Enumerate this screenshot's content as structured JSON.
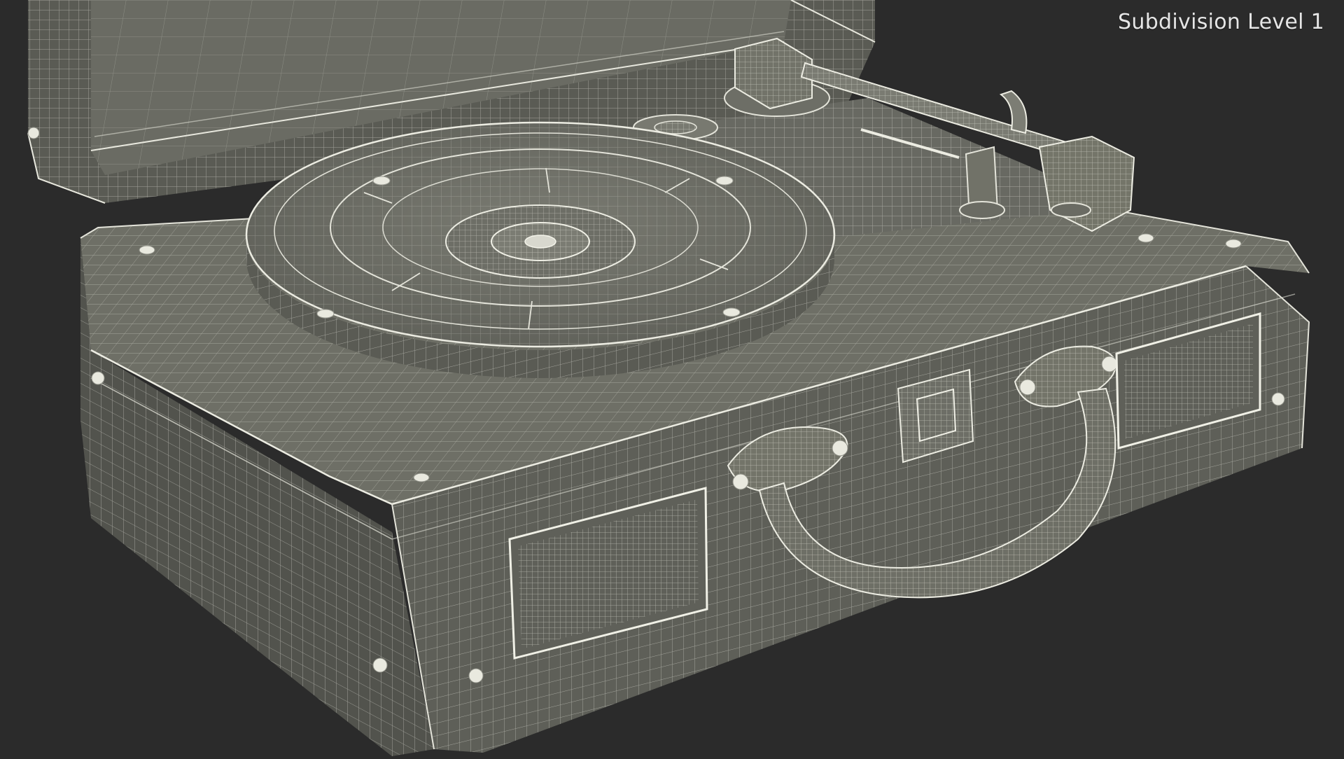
{
  "overlay": {
    "label": "Subdivision Level 1"
  },
  "scene": {
    "subject": "portable suitcase record player",
    "display_mode": "wireframe",
    "colors": {
      "background": "#2b2b2b",
      "surface": "#6e6f66",
      "surface_light": "#85867c",
      "surface_dark": "#4b4c46",
      "wire": "#dcdcd2",
      "highlight": "#f4f4ea"
    }
  }
}
